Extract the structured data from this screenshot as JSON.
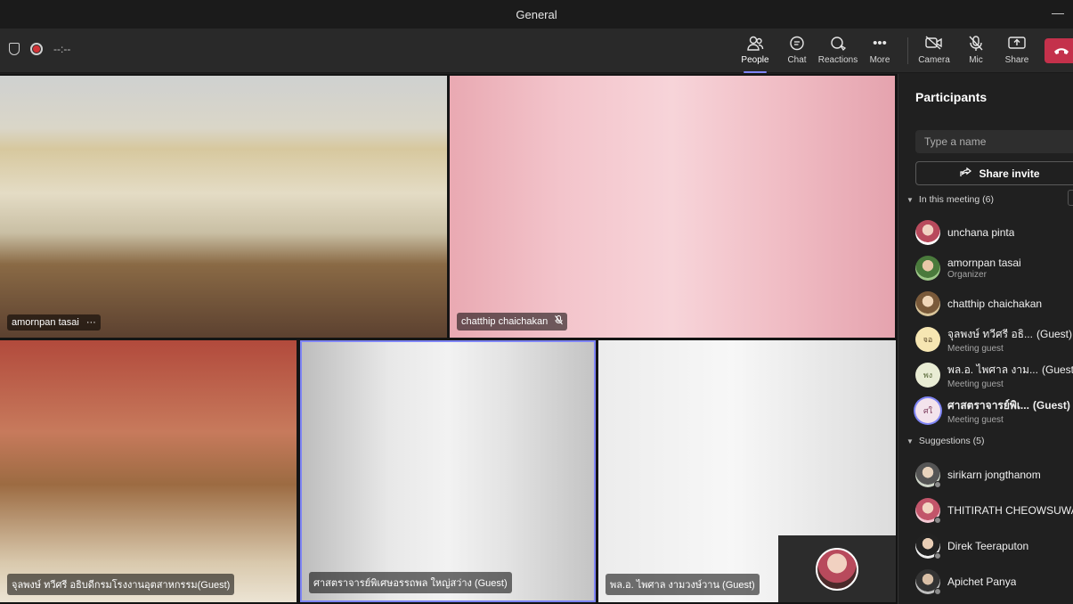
{
  "window": {
    "title": "General"
  },
  "meeting": {
    "timer": "--:--"
  },
  "toolbar": {
    "people": "People",
    "chat": "Chat",
    "reactions": "Reactions",
    "more": "More",
    "camera": "Camera",
    "mic": "Mic",
    "share": "Share"
  },
  "icons": {
    "people": "people-icon",
    "chat": "chat-icon",
    "reactions": "reactions-icon",
    "more": "more-icon",
    "camera": "camera-off-icon",
    "mic": "mic-off-icon",
    "share": "share-tray-icon",
    "leave": "hang-up-icon"
  },
  "colors": {
    "accent": "#7f85f5",
    "leave": "#c4314b"
  },
  "tiles": [
    {
      "name": "amornpan tasai",
      "extra": "···"
    },
    {
      "name": "chatthip chaichakan",
      "extra": "🎤̸"
    },
    {
      "name": "จุลพงษ์ ทวีศรี อธิบดีกรมโรงงานอุตสาหกรรม(Guest)"
    },
    {
      "name": "ศาสตราจารย์พิเศษอรรถพล ใหญ่สว่าง (Guest)"
    },
    {
      "name": "พล.อ. ไพศาล งามวงษ์วาน (Guest)"
    }
  ],
  "panel": {
    "title": "Participants",
    "search_placeholder": "Type a name",
    "share_invite": "Share invite",
    "in_meeting": "In this meeting (6)",
    "suggestions": "Suggestions (5)",
    "participants": [
      {
        "name": "unchana pinta",
        "sub": ""
      },
      {
        "name": "amornpan tasai",
        "sub": "Organizer"
      },
      {
        "name": "chatthip chaichakan",
        "sub": ""
      },
      {
        "name": "จุลพงษ์ ทวีศรี อธิ...",
        "guest": "(Guest)",
        "sub": "Meeting guest",
        "initials": "จอ"
      },
      {
        "name": "พล.อ. ไพศาล งาม...",
        "guest": "(Guest)",
        "sub": "Meeting guest",
        "initials": "พง"
      },
      {
        "name": "ศาสตราจารย์พิเ...",
        "guest": "(Guest)",
        "sub": "Meeting guest",
        "initials": "ศใ"
      }
    ],
    "suggested": [
      {
        "name": "sirikarn jongthanom"
      },
      {
        "name": "THITIRATH CHEOWSUWAN"
      },
      {
        "name": "Direk Teeraputon"
      },
      {
        "name": "Apichet Panya"
      }
    ]
  }
}
